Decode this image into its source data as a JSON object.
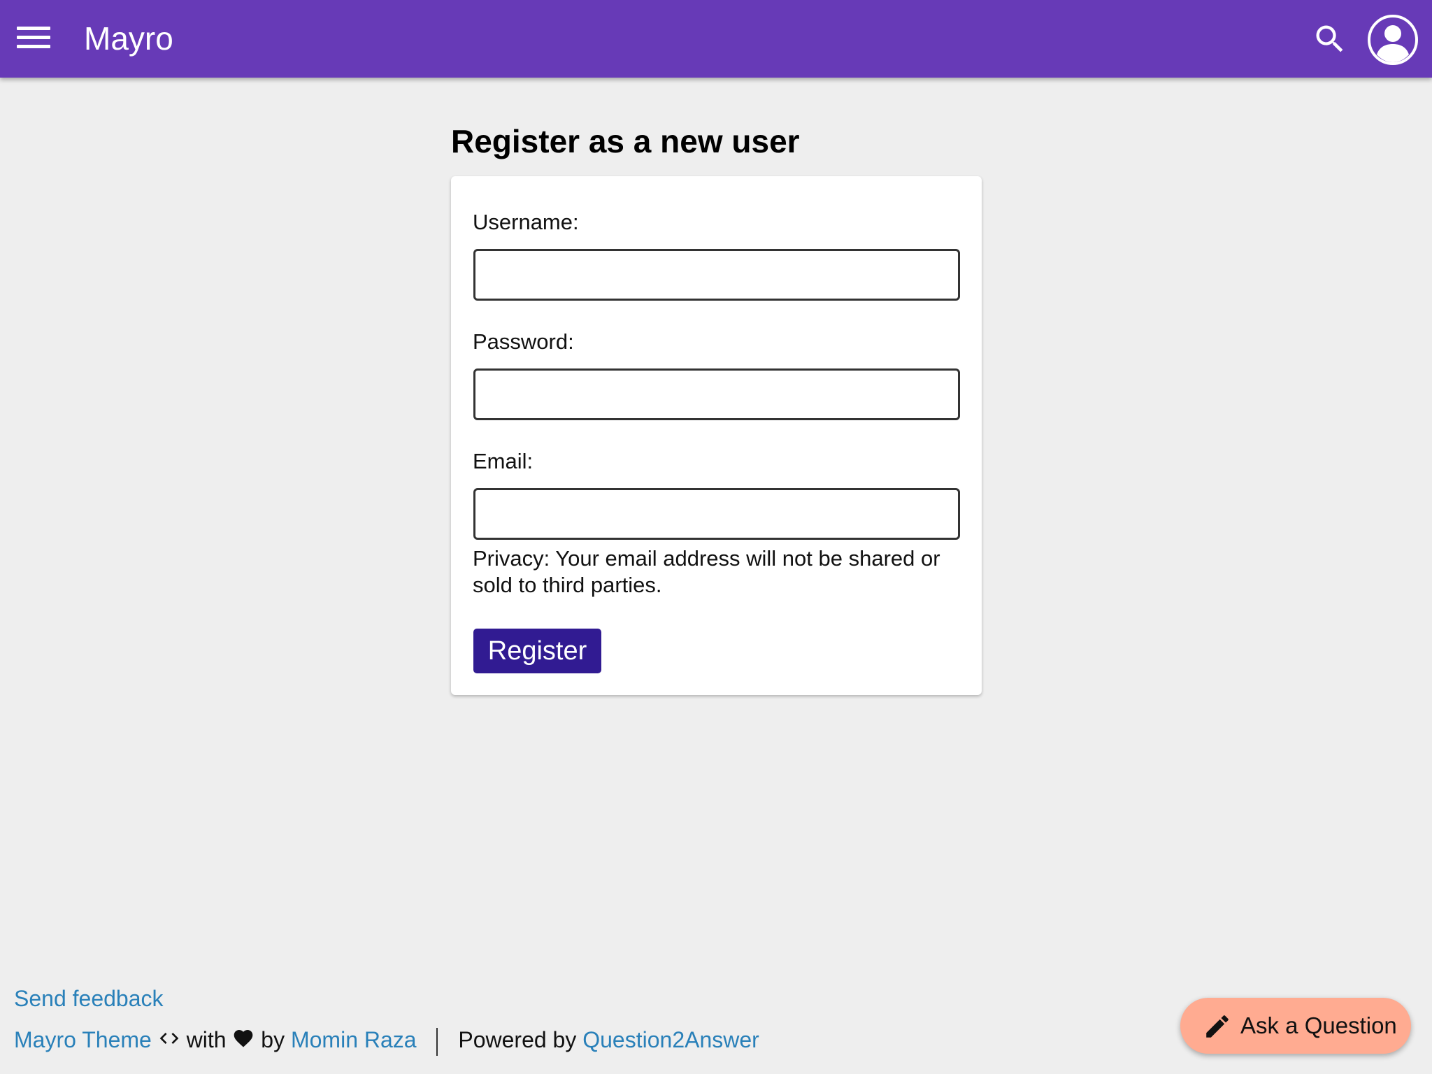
{
  "header": {
    "brand": "Mayro",
    "colors": {
      "bar": "#673ab7",
      "icons": "#ffffff"
    },
    "icons": [
      "hamburger-menu-icon",
      "search-icon",
      "account-circle-icon"
    ]
  },
  "page": {
    "title": "Register as a new user"
  },
  "form": {
    "username": {
      "label": "Username:",
      "value": "",
      "placeholder": ""
    },
    "password": {
      "label": "Password:",
      "value": "",
      "placeholder": ""
    },
    "email": {
      "label": "Email:",
      "value": "",
      "placeholder": ""
    },
    "privacy_note": "Privacy: Your email address will not be shared or sold to third parties.",
    "submit_label": "Register",
    "submit_color": "#311b92"
  },
  "footer": {
    "feedback_link": "Send feedback",
    "theme_link": "Mayro Theme",
    "with_text": "with",
    "by_text": "by",
    "author_link": "Momin Raza",
    "powered_by_text": "Powered by",
    "platform_link": "Question2Answer",
    "link_color": "#2980b9"
  },
  "fab": {
    "label": "Ask a Question",
    "icon": "pencil-icon",
    "color": "#ffab91"
  }
}
